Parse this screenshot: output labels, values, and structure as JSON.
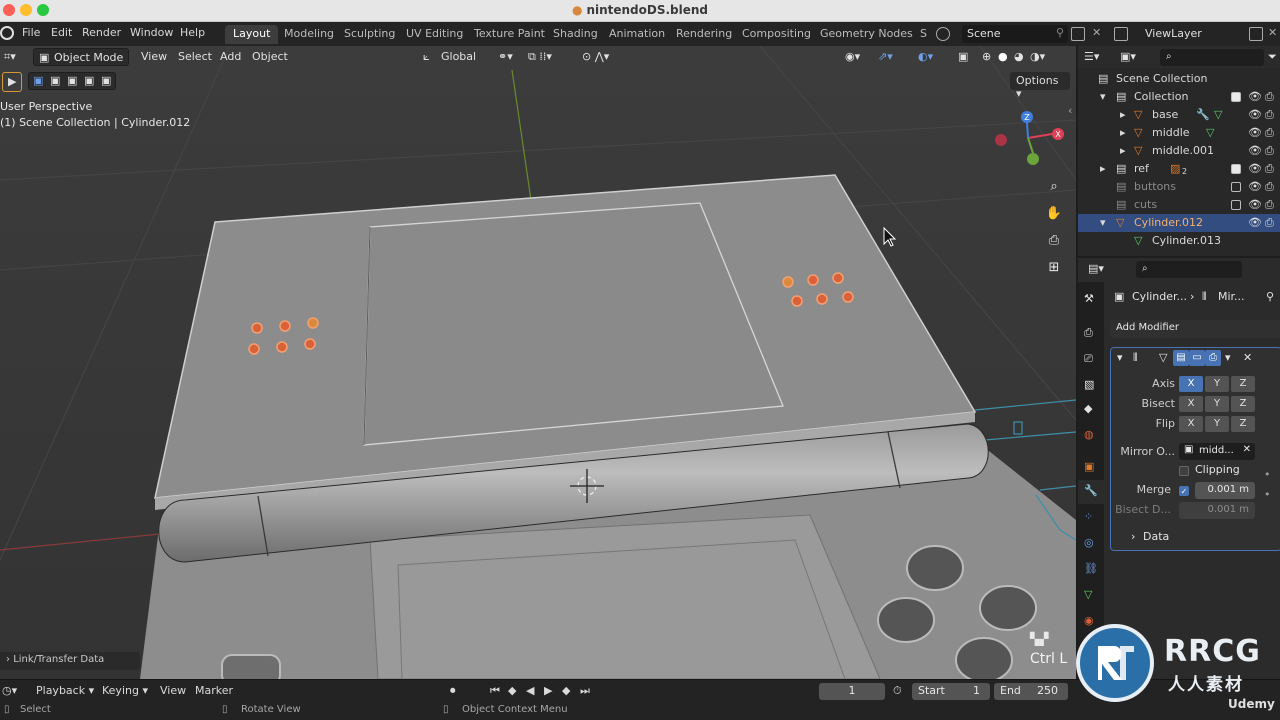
{
  "window": {
    "title": "nintendoDS.blend"
  },
  "menu": [
    "File",
    "Edit",
    "Render",
    "Window",
    "Help"
  ],
  "workspaces": [
    {
      "label": "Layout",
      "active": true
    },
    {
      "label": "Modeling",
      "active": false
    },
    {
      "label": "Sculpting",
      "active": false
    },
    {
      "label": "UV Editing",
      "active": false
    },
    {
      "label": "Texture Paint",
      "active": false
    },
    {
      "label": "Shading",
      "active": false
    },
    {
      "label": "Animation",
      "active": false
    },
    {
      "label": "Rendering",
      "active": false
    },
    {
      "label": "Compositing",
      "active": false
    },
    {
      "label": "Geometry Nodes",
      "active": false
    },
    {
      "label": "S",
      "active": false
    }
  ],
  "scene": {
    "name": "Scene"
  },
  "view_layer": {
    "name": "ViewLayer"
  },
  "viewport_header": {
    "mode": "Object Mode",
    "menus": [
      "View",
      "Select",
      "Add",
      "Object"
    ],
    "orientation": "Global",
    "options_label": "Options"
  },
  "viewport_overlay": {
    "perspective": "User Perspective",
    "context": "(1) Scene Collection | Cylinder.012",
    "last_operator": "Link/Transfer Data",
    "shortcut_display": "Ctrl L"
  },
  "outliner": {
    "rows": [
      {
        "label": "Scene Collection",
        "kind": "scene",
        "selected": false,
        "dim": false
      },
      {
        "label": "Collection",
        "kind": "collection",
        "selected": false,
        "dim": false
      },
      {
        "label": "base",
        "kind": "mesh",
        "selected": false,
        "dim": false
      },
      {
        "label": "middle",
        "kind": "mesh",
        "selected": false,
        "dim": false
      },
      {
        "label": "middle.001",
        "kind": "mesh",
        "selected": false,
        "dim": false
      },
      {
        "label": "ref",
        "kind": "collection",
        "selected": false,
        "dim": false
      },
      {
        "label": "buttons",
        "kind": "collection",
        "selected": false,
        "dim": true
      },
      {
        "label": "cuts",
        "kind": "collection",
        "selected": false,
        "dim": true
      },
      {
        "label": "Cylinder.012",
        "kind": "mesh",
        "selected": true,
        "dim": false
      },
      {
        "label": "Cylinder.013",
        "kind": "data",
        "selected": false,
        "dim": false
      }
    ],
    "ref_badge": "2"
  },
  "properties": {
    "breadcrumb_object": "Cylinder...",
    "breadcrumb_modifier": "Mir...",
    "add_modifier": "Add Modifier",
    "axis_label": "Axis",
    "bisect_label": "Bisect",
    "flip_label": "Flip",
    "axes": [
      "X",
      "Y",
      "Z"
    ],
    "mirror_object_label": "Mirror O...",
    "mirror_object_value": "midd...",
    "clipping_label": "Clipping",
    "merge_label": "Merge",
    "merge_value": "0.001 m",
    "bisect_distance_label": "Bisect D...",
    "bisect_distance_value": "0.001 m",
    "data_label": "Data"
  },
  "timeline": {
    "menus": [
      "Playback",
      "Keying",
      "View",
      "Marker"
    ],
    "current_frame": "1",
    "start_label": "Start",
    "start_value": "1",
    "end_label": "End",
    "end_value": "250"
  },
  "statusbar": [
    "Select",
    "Rotate View",
    "Object Context Menu"
  ],
  "watermark": {
    "title": "RRCG",
    "subtitle": "人人素材",
    "platform": "Udemy"
  },
  "colors": {
    "accent": "#4772b3",
    "selected_row": "#334d80",
    "orange": "#e07a2a",
    "viewport_bg": "#3a3a3a"
  }
}
